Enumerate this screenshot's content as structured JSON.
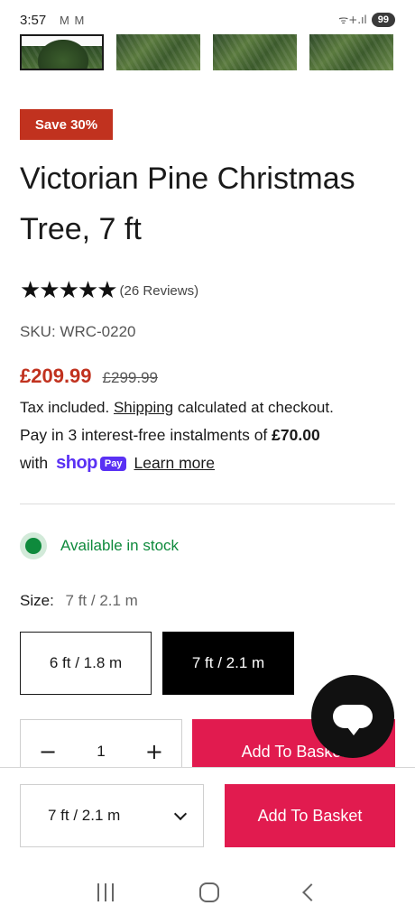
{
  "status_bar": {
    "time": "3:57",
    "notif": "M M",
    "wifi": "ᯤ+.ıl",
    "battery": "99"
  },
  "badge": {
    "save": "Save 30%"
  },
  "product": {
    "title": "Victorian Pine Christmas Tree, 7 ft",
    "stars": "★★★★★",
    "reviews": "(26 Reviews)",
    "sku": "SKU: WRC-0220",
    "price": "£209.99",
    "compare_price": "£299.99"
  },
  "tax": {
    "prefix": "Tax included.",
    "link": "Shipping",
    "suffix": "calculated at checkout."
  },
  "installments": {
    "text": "Pay in 3 interest-free instalments of",
    "amount": "£70.00",
    "with": "with",
    "shop": "shop",
    "pay": "Pay",
    "learn_more": "Learn more"
  },
  "stock": {
    "text": "Available in stock"
  },
  "size": {
    "label": "Size:",
    "selected": "7 ft / 2.1 m",
    "options": [
      "6 ft / 1.8 m",
      "7 ft / 2.1 m"
    ]
  },
  "quantity": {
    "minus": "−",
    "value": "1",
    "plus": "+"
  },
  "buttons": {
    "add_to_basket": "Add To Basket"
  },
  "sticky": {
    "selected_size": "7 ft / 2.1 m",
    "add_to_basket": "Add To Basket"
  },
  "colors": {
    "accent": "#e11b4f",
    "sale": "#c1321f",
    "stock": "#0e8a3c",
    "shop_pay": "#5a31f4"
  }
}
